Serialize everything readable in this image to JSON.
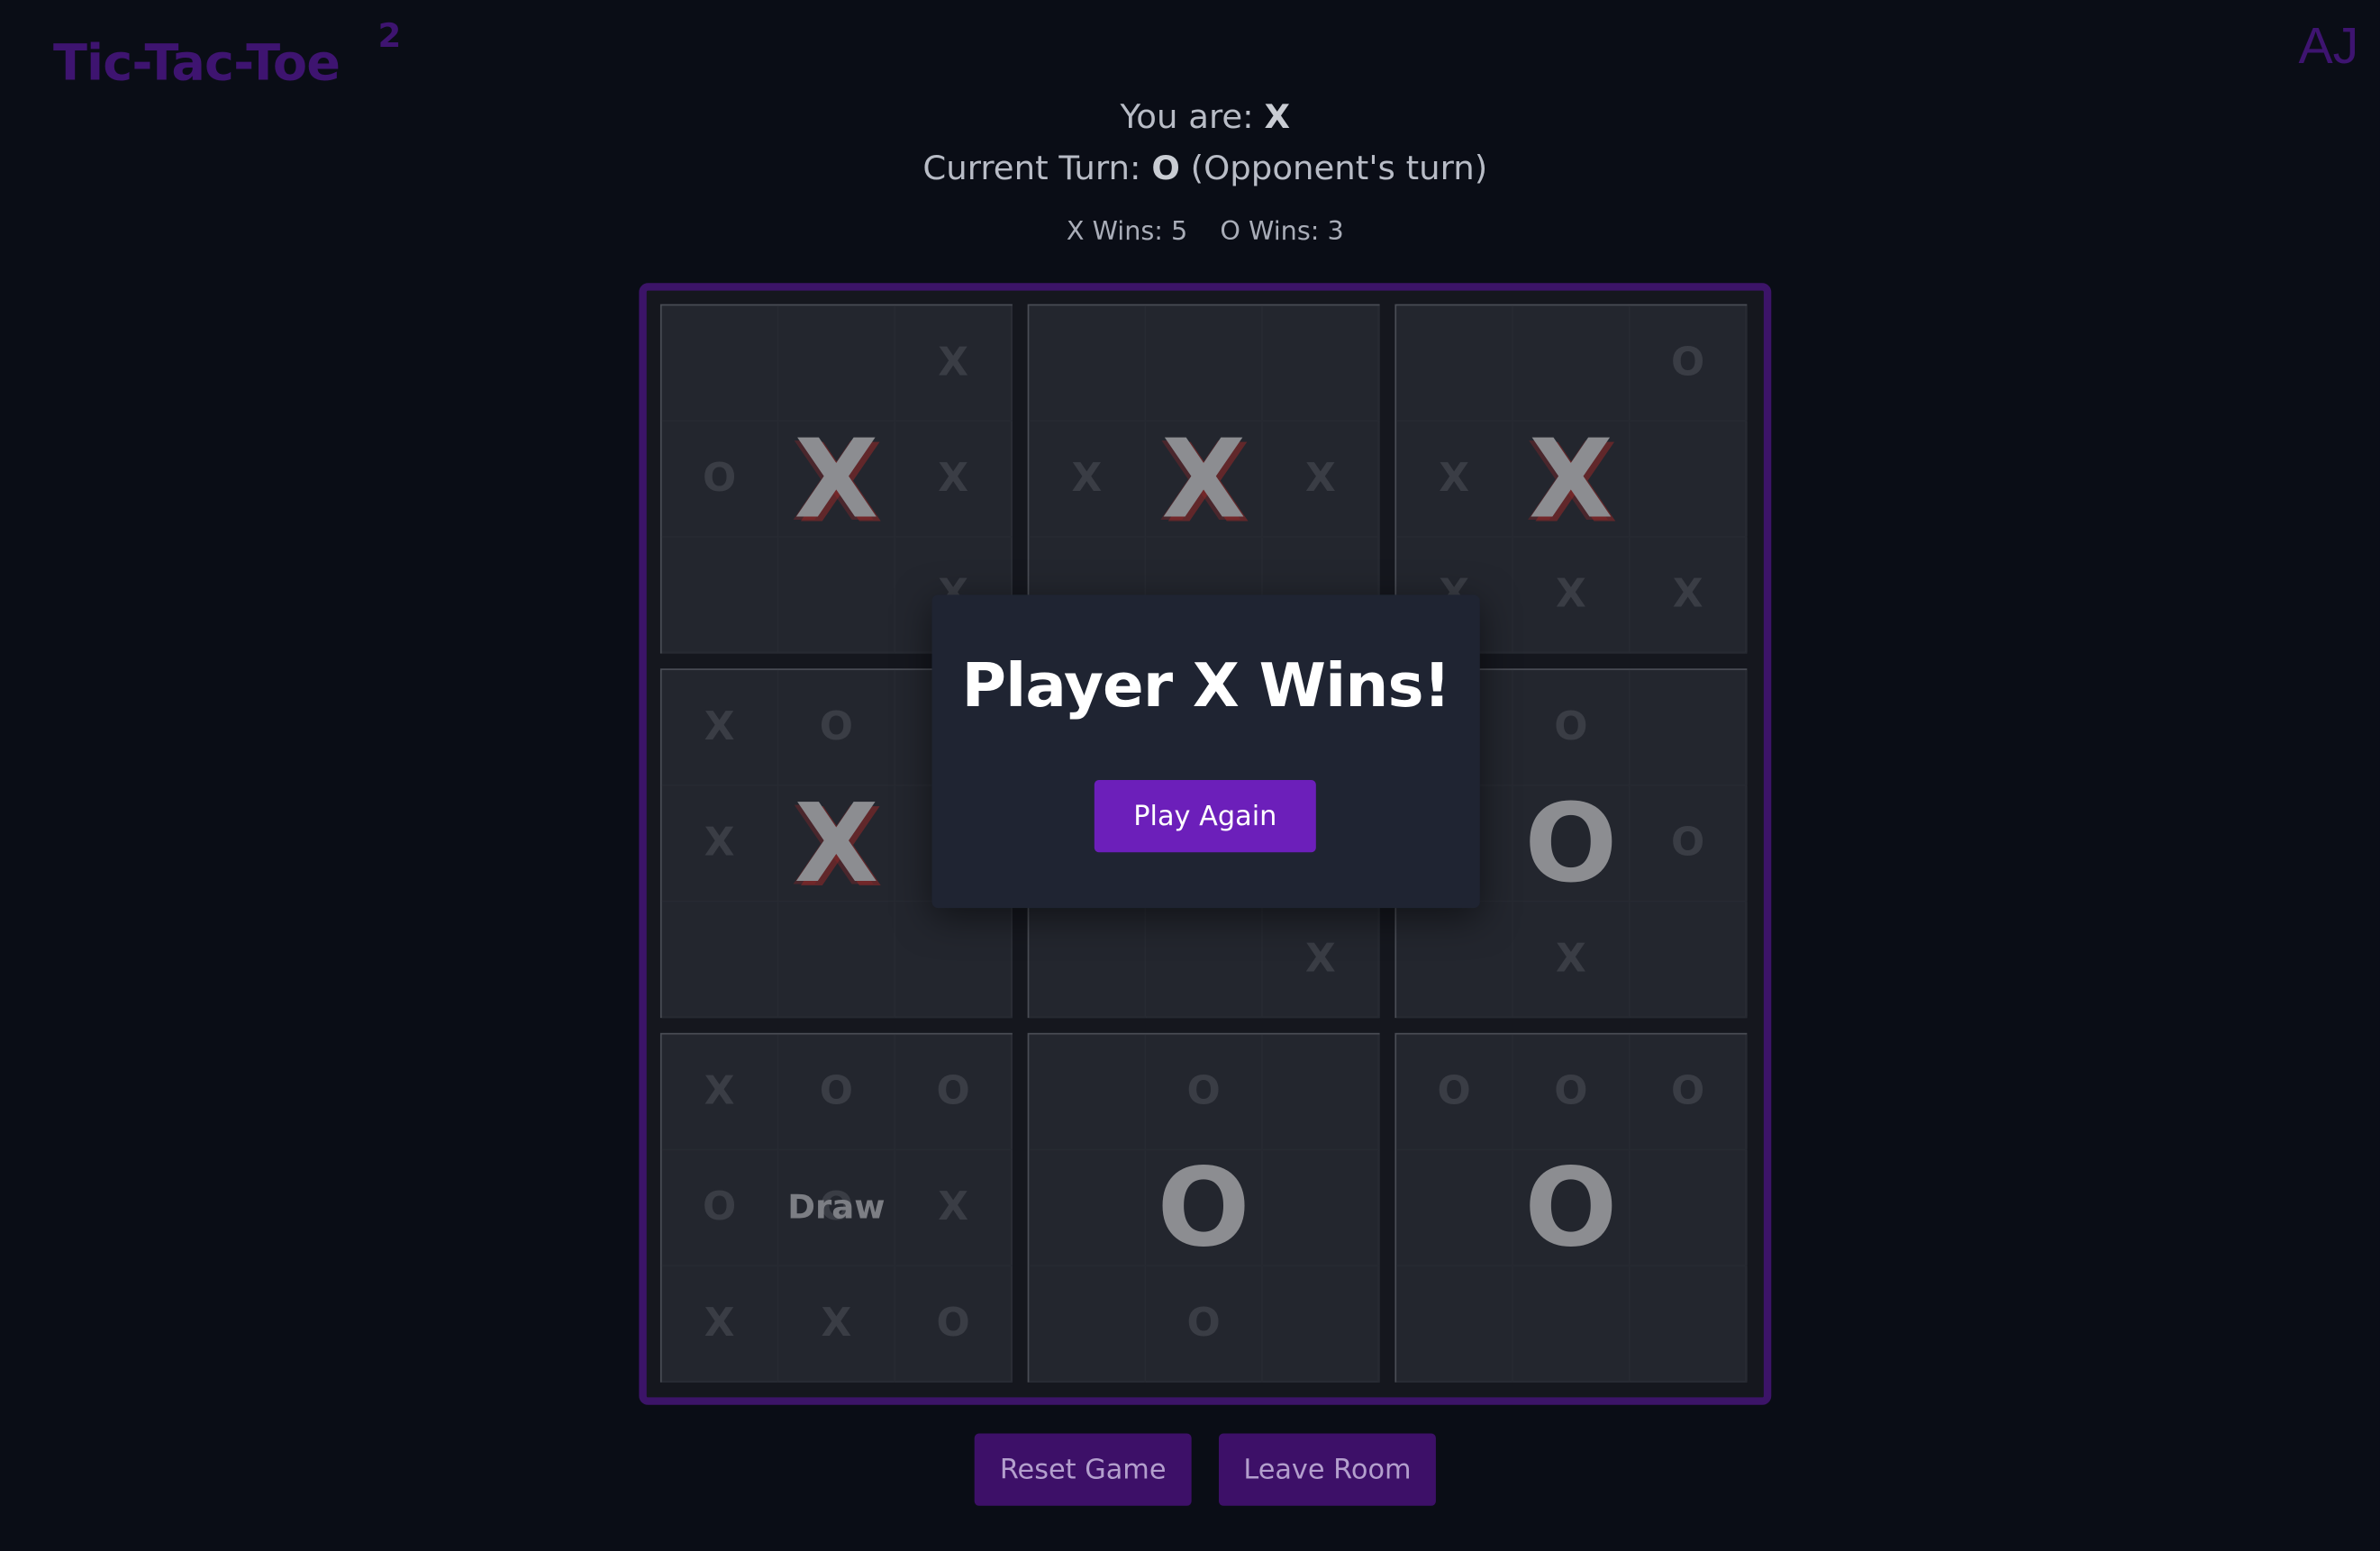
{
  "app": {
    "title": "Tic-Tac-Toe",
    "title_superscript": "2",
    "user_initials": "AJ"
  },
  "status": {
    "you_are_label": "You are:",
    "you_are_symbol": "X",
    "current_turn_label": "Current Turn:",
    "current_turn_symbol": "O",
    "current_turn_note": "(Opponent's turn)"
  },
  "scores": {
    "x_wins": "X Wins: 5",
    "o_wins": "O Wins: 3"
  },
  "board": {
    "mega_cells": [
      {
        "winner": "X",
        "minis": [
          "",
          "",
          "X",
          "O",
          "",
          "X",
          "",
          "",
          "X"
        ]
      },
      {
        "winner": "X",
        "minis": [
          "",
          "",
          "",
          "X",
          "",
          "X",
          "",
          "",
          ""
        ]
      },
      {
        "winner": "X",
        "minis": [
          "",
          "",
          "O",
          "X",
          "",
          "",
          "X",
          "X",
          "X"
        ]
      },
      {
        "winner": "X",
        "minis": [
          "X",
          "O",
          "",
          "X",
          "",
          "",
          "",
          "",
          ""
        ]
      },
      {
        "winner": "",
        "minis": [
          "",
          "",
          "",
          "",
          "",
          "",
          "",
          "",
          "X"
        ]
      },
      {
        "winner": "O",
        "minis": [
          "",
          "O",
          "",
          "",
          "",
          "O",
          "",
          "X",
          ""
        ]
      },
      {
        "winner": "Draw",
        "minis": [
          "X",
          "O",
          "O",
          "O",
          "O",
          "X",
          "X",
          "X",
          "O"
        ]
      },
      {
        "winner": "O",
        "minis": [
          "",
          "O",
          "",
          "",
          "",
          "",
          "",
          "O",
          ""
        ]
      },
      {
        "winner": "O",
        "minis": [
          "O",
          "O",
          "O",
          "",
          "",
          "",
          "",
          "",
          ""
        ]
      }
    ]
  },
  "modal": {
    "title": "Player X Wins!",
    "play_again_label": "Play Again"
  },
  "controls": {
    "reset_label": "Reset Game",
    "leave_label": "Leave Room"
  },
  "colors": {
    "background": "#0a0d16",
    "accent": "#6c1fba",
    "board_border": "#3c1468"
  }
}
